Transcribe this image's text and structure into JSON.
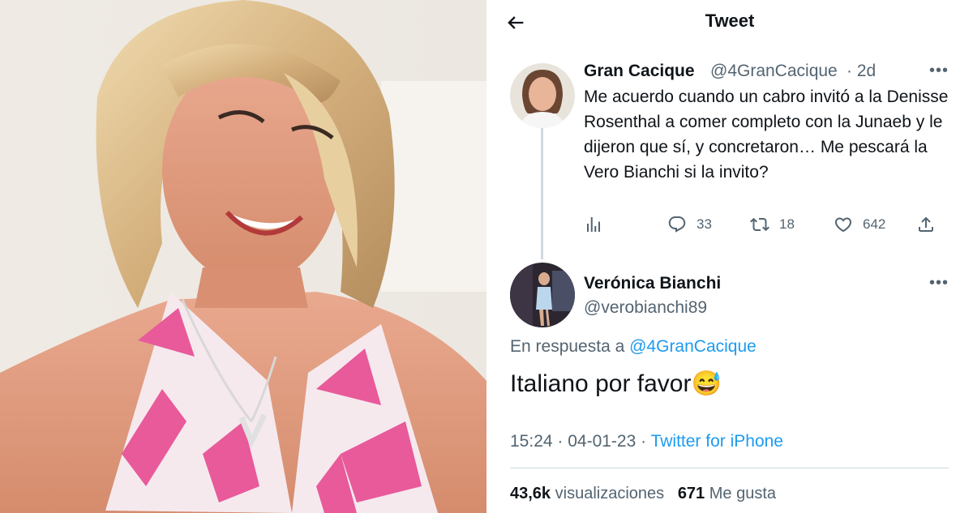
{
  "header": {
    "title": "Tweet"
  },
  "tweet": {
    "name": "Gran Cacique",
    "handle": "@4GranCacique",
    "time": "· 2d",
    "text": "Me acuerdo cuando un cabro invitó a la Denisse Rosenthal a comer completo con la Junaeb y le dijeron que sí, y concretaron… Me pescará la Vero Bianchi si la invito?",
    "stats": {
      "replies": "33",
      "retweets": "18",
      "likes": "642"
    }
  },
  "reply": {
    "name": "Verónica Bianchi",
    "handle": "@verobianchi89",
    "replying_prefix": "En respuesta a",
    "replying_to": "@4GranCacique",
    "text": "Italiano por favor😅",
    "time": "15:24 · 04-01-23 ·",
    "source": "Twitter for iPhone",
    "views_count": "43,6k",
    "views_label": "visualizaciones",
    "likes_count": "671",
    "likes_label": "Me gusta"
  },
  "colors": {
    "accent": "#1d9bf0",
    "muted": "#536471",
    "text": "#0f1419"
  },
  "icons": [
    "back-arrow-icon",
    "more-icon",
    "views-icon",
    "reply-icon",
    "retweet-icon",
    "like-icon",
    "share-icon"
  ]
}
